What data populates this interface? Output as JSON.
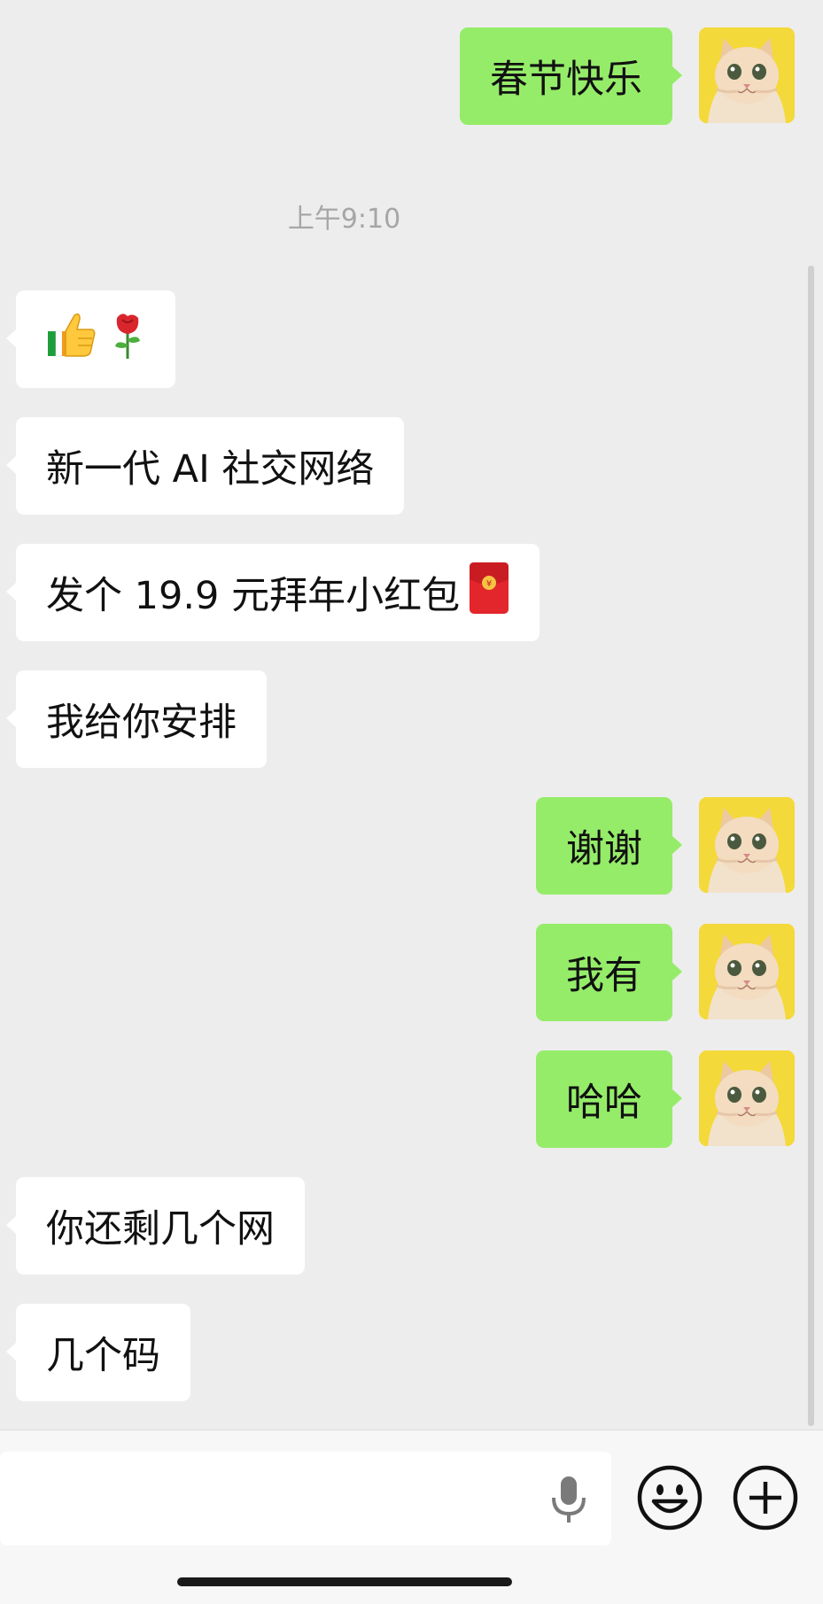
{
  "timestamp": "上午9:10",
  "messages": [
    {
      "side": "out",
      "text": "春节快乐"
    },
    {
      "side": "in",
      "emoji": [
        "thumbs-up-icon",
        "rose-icon"
      ]
    },
    {
      "side": "in",
      "text": "新一代 AI 社交网络"
    },
    {
      "side": "in",
      "text": "发个 19.9 元拜年小红包",
      "trailing_icon": "red-envelope-icon"
    },
    {
      "side": "in",
      "text": "我给你安排"
    },
    {
      "side": "out",
      "text": "谢谢"
    },
    {
      "side": "out",
      "text": "我有"
    },
    {
      "side": "out",
      "text": "哈哈"
    },
    {
      "side": "in",
      "text": "你还剩几个网"
    },
    {
      "side": "in",
      "text": "几个码"
    }
  ],
  "input_bar": {
    "value": "",
    "icons": [
      "microphone-icon",
      "emoji-smiley-icon",
      "plus-circle-icon"
    ]
  },
  "colors": {
    "background": "#ededed",
    "outgoing_bubble": "#95ec69",
    "incoming_bubble": "#ffffff",
    "timestamp_text": "#a6a6a6"
  },
  "avatar": {
    "icon": "cat-avatar-icon",
    "background": "#f4d93a"
  }
}
